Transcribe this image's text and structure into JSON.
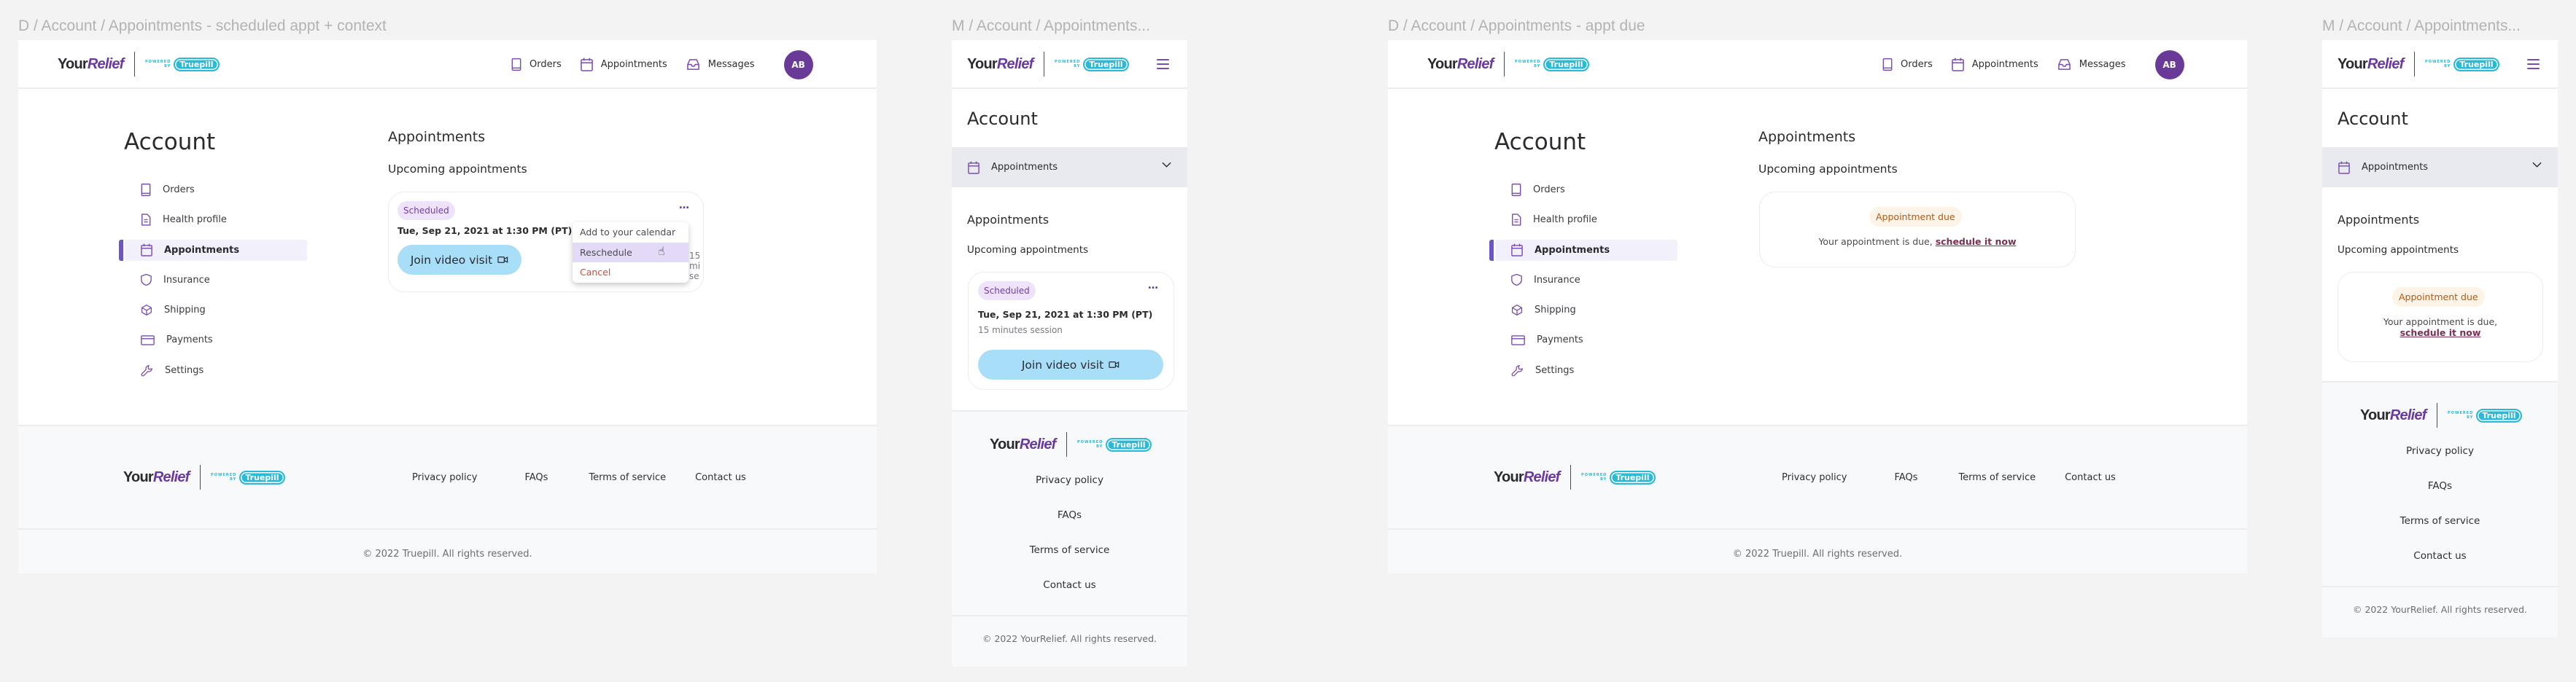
{
  "frames": {
    "f1": {
      "label": "D / Account / Appointments - scheduled appt + context"
    },
    "f2": {
      "label": "M / Account / Appointments..."
    },
    "f3": {
      "label": "D / Account / Appointments - appt due"
    },
    "f4": {
      "label": "M / Account / Appointments..."
    }
  },
  "brand": {
    "your": "Your",
    "relief": "Relief",
    "powered": "POWERED",
    "by": "BY",
    "truepill": "Truepill",
    "accent": "#6a3aa0",
    "truepill_color": "#2ab9d7"
  },
  "topnav": {
    "items": [
      {
        "label": "Orders",
        "icon": "book-icon"
      },
      {
        "label": "Appointments",
        "icon": "calendar-icon"
      },
      {
        "label": "Messages",
        "icon": "inbox-icon"
      }
    ],
    "avatar_initials": "AB"
  },
  "account": {
    "title": "Account",
    "sidebar": [
      {
        "label": "Orders",
        "icon": "book-icon"
      },
      {
        "label": "Health profile",
        "icon": "document-icon"
      },
      {
        "label": "Appointments",
        "icon": "calendar-icon",
        "active": true
      },
      {
        "label": "Insurance",
        "icon": "shield-icon"
      },
      {
        "label": "Shipping",
        "icon": "box-icon"
      },
      {
        "label": "Payments",
        "icon": "credit-card-icon"
      },
      {
        "label": "Settings",
        "icon": "wrench-icon"
      }
    ],
    "mobile_section_selected": "Appointments"
  },
  "appointments": {
    "title": "Appointments",
    "upcoming_title": "Upcoming appointments",
    "scheduled": {
      "status": "Scheduled",
      "datetime": "Tue, Sep 21, 2021 at 1:30 PM (PT)",
      "session": "15 minutes session",
      "join_label": "Join video visit",
      "more_label": "…"
    },
    "context_menu": [
      {
        "label": "Add to your calendar"
      },
      {
        "label": "Reschedule",
        "hovered": true
      },
      {
        "label": "Cancel",
        "danger": true
      }
    ],
    "due": {
      "status": "Appointment due",
      "text": "Your appointment is due,",
      "link": "schedule it now"
    }
  },
  "footer": {
    "links": [
      "Privacy policy",
      "FAQs",
      "Terms of service",
      "Contact us"
    ],
    "copyright_desktop": "© 2022 Truepill. All rights reserved.",
    "copyright_mobile": "© 2022 YourRelief. All rights reserved."
  },
  "colors": {
    "scheduled_bg": "#efe3fb",
    "scheduled_text": "#6e3ea4",
    "due_bg": "#fdf3e6",
    "due_text": "#b5590f",
    "join_bg": "#a9def8",
    "avatar_bg": "#6a3a99",
    "cancel": "#cc4a3a"
  }
}
